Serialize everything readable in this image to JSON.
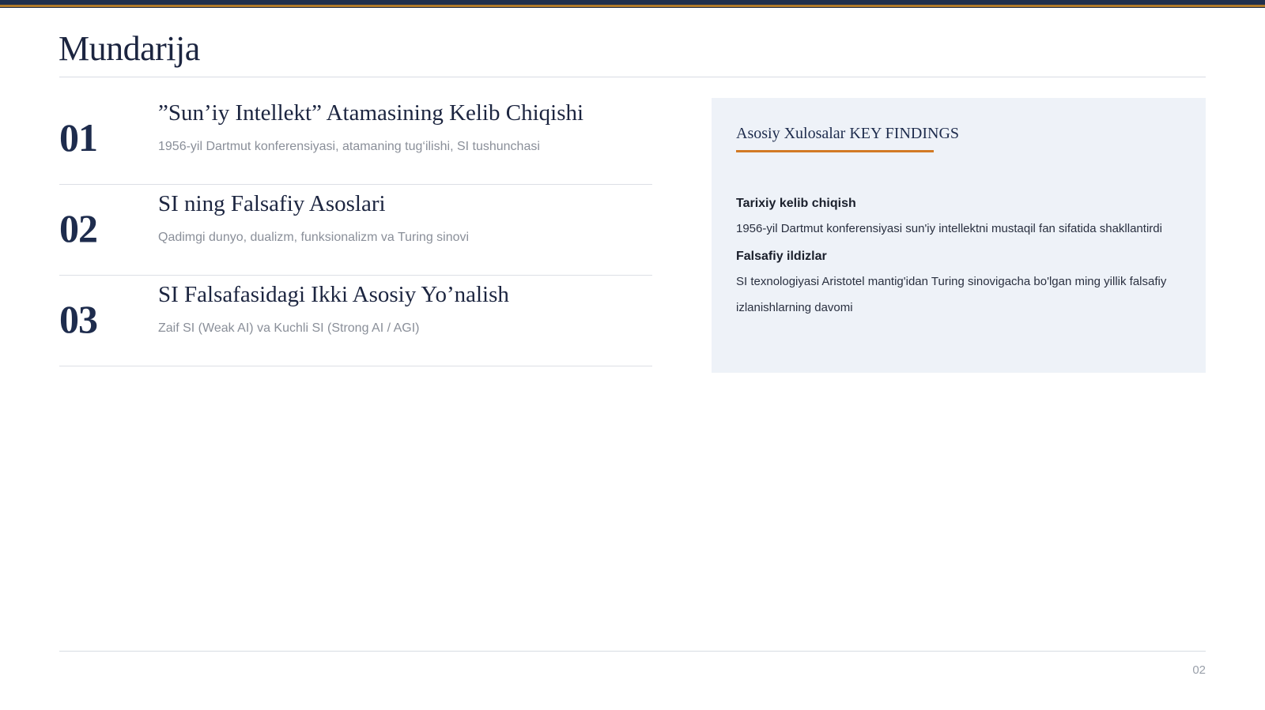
{
  "slide": {
    "title": "Mundarija",
    "page_number": "02"
  },
  "toc": [
    {
      "number": "01",
      "title": "”Sun’iy Intellekt” Atamasining Kelib Chiqishi",
      "subtitle": "1956-yil Dartmut konferensiyasi, atamaning tug‘ilishi, SI tushunchasi"
    },
    {
      "number": "02",
      "title": "SI ning Falsafiy Asoslari",
      "subtitle": "Qadimgi dunyo, dualizm, funksionalizm va Turing sinovi"
    },
    {
      "number": "03",
      "title": "SI Falsafasidagi Ikki Asosiy Yo’nalish",
      "subtitle": "Zaif SI (Weak AI) va Kuchli SI (Strong AI / AGI)"
    }
  ],
  "findings": {
    "title": "Asosiy Xulosalar KEY FINDINGS",
    "items": [
      {
        "heading": "Tarixiy kelib chiqish",
        "text": "1956-yil Dartmut konferensiyasi sun'iy intellektni mustaqil fan sifatida shakllantirdi"
      },
      {
        "heading": "Falsafiy ildizlar",
        "text": "SI texnologiyasi Aristotel mantig'idan Turing sinovigacha bo'lgan ming yillik falsafiy izlanishlarning davomi"
      }
    ]
  },
  "colors": {
    "navy": "#1e2c4d",
    "accent_orange": "#d27a25",
    "panel_bg": "#eef2f8"
  }
}
